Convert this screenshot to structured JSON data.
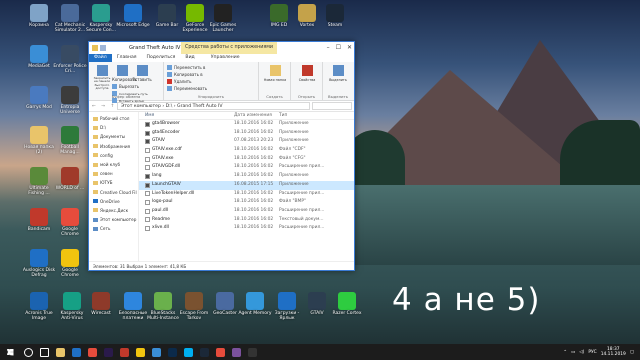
{
  "desktop": {
    "icons": [
      {
        "label": "Корзина",
        "color": "#7fa3c7"
      },
      {
        "label": "Cat Mechanic Simulator 2...",
        "color": "#4a6a9a"
      },
      {
        "label": "Kaspersky Secure Con...",
        "color": "#2a9d8f"
      },
      {
        "label": "Microsoft Edge",
        "color": "#1f6fc5"
      },
      {
        "label": "MediaGet",
        "color": "#3a8ed6"
      },
      {
        "label": "Enforcer Police Cri...",
        "color": "#384b63"
      },
      {
        "label": "Garrys Mod",
        "color": "#4a7abf"
      },
      {
        "label": "Entropia Universe",
        "color": "#3c3c3c"
      },
      {
        "label": "Новая папка (2)",
        "color": "#e9c46a"
      },
      {
        "label": "Football Manag...",
        "color": "#2d7a3a"
      },
      {
        "label": "Ultimate Fishing ...",
        "color": "#5a8a3a"
      },
      {
        "label": "WORLD of ...",
        "color": "#a03a2a"
      },
      {
        "label": "Bandicam",
        "color": "#c0392b"
      },
      {
        "label": "Google Chrome",
        "color": "#e74c3c"
      },
      {
        "label": "Auslogics Disk Defrag",
        "color": "#1f6fc5"
      },
      {
        "label": "Google Chrome",
        "color": "#f1c40f"
      },
      {
        "label": "Acronis True Image",
        "color": "#1b63b0"
      },
      {
        "label": "Kaspersky Anti-Virus",
        "color": "#16a085"
      },
      {
        "label": "Wirecast",
        "color": "#8e3a2a"
      },
      {
        "label": "Безопасные платежи",
        "color": "#2e86de"
      },
      {
        "label": "BlueStacks Multi-Instance",
        "color": "#6ab04c"
      },
      {
        "label": "Escape From Tarkov",
        "color": "#7a5230"
      },
      {
        "label": "GeoCaster",
        "color": "#4a6aa0"
      },
      {
        "label": "Agent Memory",
        "color": "#3498db"
      },
      {
        "label": "Загрузки - Ярлык",
        "color": "#1f6fc5"
      },
      {
        "label": "GTAIV",
        "color": "#2c3e50"
      },
      {
        "label": "Razer Cortex",
        "color": "#2ecc40"
      },
      {
        "label": "Game Bar",
        "color": "#2c3e50"
      },
      {
        "label": "GeForce Experience",
        "color": "#76b900"
      },
      {
        "label": "Epic Games Launcher",
        "color": "#222222"
      },
      {
        "label": "IMG ED",
        "color": "#3a6a2a"
      },
      {
        "label": "Vortex",
        "color": "#c4a24a"
      },
      {
        "label": "Steam",
        "color": "#1b2838"
      }
    ],
    "overlay_text": "4 а не 5)"
  },
  "explorer": {
    "window_title": "Grand Theft Auto IV",
    "context_tab": "Средства работы с приложениями",
    "menu": {
      "file": "Файл",
      "home": "Главная",
      "share": "Поделиться",
      "view": "Вид",
      "manage": "Управление"
    },
    "ribbon": {
      "pin_label": "Закрепить на панели быстрого доступа",
      "copy": "Копировать",
      "paste": "Вставить",
      "cut": "Вырезать",
      "copy_path": "Скопировать путь",
      "paste_shortcut": "Вставить ярлык",
      "clipboard_group": "Буфер обмена",
      "move_to": "Переместить в",
      "copy_to": "Копировать в",
      "delete": "Удалить",
      "rename": "Переименовать",
      "organize_group": "Упорядочить",
      "new_folder": "Новая папка",
      "create_group": "Создать",
      "properties": "Свойства",
      "open_group": "Открыть",
      "select": "Выделить",
      "select_group": "Выделить"
    },
    "address": "Этот компьютер › D:\\ › Grand Theft Auto IV",
    "columns": {
      "name": "Имя",
      "date": "Дата изменения",
      "type": "Тип"
    },
    "nav_items": [
      "Рабочий стол",
      "D:\\",
      "Документы",
      "Изображения",
      "config",
      "мой клуб",
      "севен",
      "ЮТУБ",
      "Creative Cloud Fil",
      "OneDrive",
      "Яндекс.Диск",
      "Этот компьютер",
      "Сеть"
    ],
    "files": [
      {
        "name": "gta4Browser",
        "date": "18.10.2016 16:02",
        "type": "Приложение",
        "icon": "#4b4b4b"
      },
      {
        "name": "gta4Encoder",
        "date": "18.10.2016 16:02",
        "type": "Приложение",
        "icon": "#4b4b4b"
      },
      {
        "name": "GTAIV",
        "date": "07.08.2013 20:23",
        "type": "Приложение",
        "icon": "#4b4b4b"
      },
      {
        "name": "GTAIV.exe.cdf",
        "date": "18.10.2016 16:02",
        "type": "Файл \"CDF\"",
        "icon": "#ffffff"
      },
      {
        "name": "GTAIV.exe",
        "date": "18.10.2016 16:02",
        "type": "Файл \"CFG\"",
        "icon": "#ffffff"
      },
      {
        "name": "GTAIVGDF.dll",
        "date": "18.10.2016 16:02",
        "type": "Расширение прил...",
        "icon": "#ffffff"
      },
      {
        "name": "lang",
        "date": "18.10.2016 16:02",
        "type": "Приложение",
        "icon": "#4b4b4b"
      },
      {
        "name": "LaunchGTAIV",
        "date": "16.08.2015 17:15",
        "type": "Приложение",
        "icon": "#4b4b4b"
      },
      {
        "name": "LiveTokenHelper.dll",
        "date": "18.10.2016 16:02",
        "type": "Расширение прил...",
        "icon": "#ffffff"
      },
      {
        "name": "logo-paul",
        "date": "18.10.2016 16:02",
        "type": "Файл \"BMP\"",
        "icon": "#ffffff"
      },
      {
        "name": "paul.dll",
        "date": "18.10.2016 16:02",
        "type": "Расширение прил...",
        "icon": "#ffffff"
      },
      {
        "name": "Readme",
        "date": "18.10.2016 16:02",
        "type": "Текстовый докум...",
        "icon": "#ffffff"
      },
      {
        "name": "xlive.dll",
        "date": "18.10.2016 16:02",
        "type": "Расширение прил...",
        "icon": "#ffffff"
      }
    ],
    "selected_index": 7,
    "status": "Элементов: 31    Выбран 1 элемент: 41,8 КБ"
  },
  "taskbar": {
    "icons": [
      {
        "name": "search",
        "color": "#ffffff"
      },
      {
        "name": "task-view",
        "color": "#ffffff"
      },
      {
        "name": "explorer",
        "color": "#e9c46a"
      },
      {
        "name": "store",
        "color": "#1f6fc5"
      },
      {
        "name": "yandex",
        "color": "#e74c3c"
      },
      {
        "name": "premiere",
        "color": "#2a1a4a"
      },
      {
        "name": "bandicam",
        "color": "#c0392b"
      },
      {
        "name": "chrome",
        "color": "#f1c40f"
      },
      {
        "name": "mail",
        "color": "#3a8ed6"
      },
      {
        "name": "photoshop",
        "color": "#0b2a4a"
      },
      {
        "name": "skype",
        "color": "#00aff0"
      },
      {
        "name": "steam",
        "color": "#1b2838"
      },
      {
        "name": "opera",
        "color": "#e74c3c"
      },
      {
        "name": "viber",
        "color": "#7b519d"
      },
      {
        "name": "obs",
        "color": "#333333"
      }
    ],
    "language": "РУС",
    "time": "18:37",
    "date": "14.11.2019"
  }
}
